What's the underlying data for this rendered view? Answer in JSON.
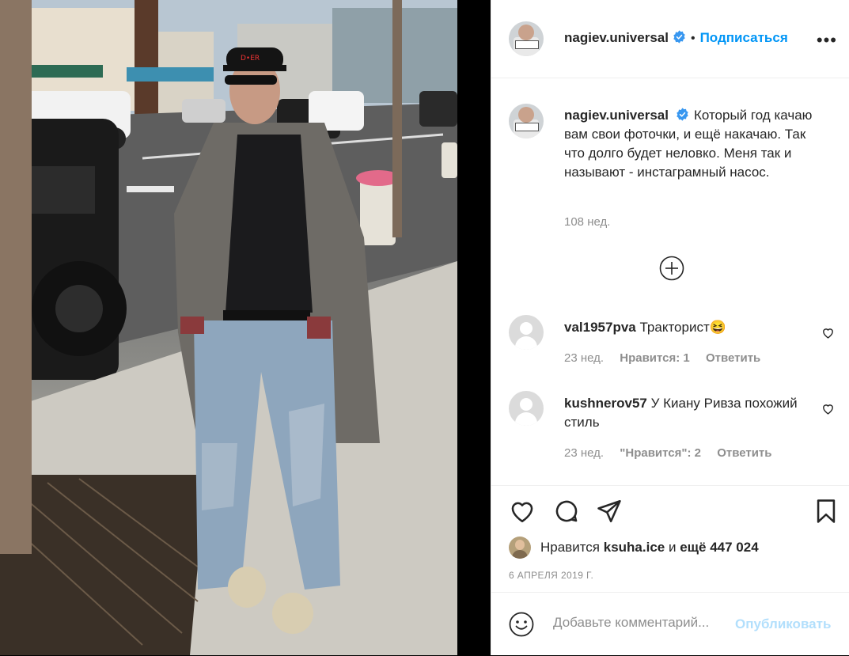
{
  "colors": {
    "accent": "#0095f6",
    "publish_disabled": "#b2dffc",
    "secondary_text": "#8e8e8e",
    "primary_text": "#262626"
  },
  "header": {
    "username": "nagiev.universal",
    "verified_icon": "verified-badge-icon",
    "separator": "•",
    "follow_label": "Подписаться",
    "more_label": "•••"
  },
  "caption": {
    "username": "nagiev.universal",
    "text": "Который год качаю вам свои фоточки, и ещё накачаю. Так что долго будет неловко. Меня так и называют - инстаграмный насос.",
    "age": "108 нед."
  },
  "load_more_icon": "circle-plus-icon",
  "comments": [
    {
      "username": "val1957pva",
      "text": "Тракторист😆",
      "age": "23 нед.",
      "likes": "Нравится: 1",
      "reply": "Ответить"
    },
    {
      "username": "kushnerov57",
      "text": "У Киану Ривза похожий стиль",
      "age": "23 нед.",
      "likes": "\"Нравится\": 2",
      "reply": "Ответить"
    }
  ],
  "likes": {
    "prefix": "Нравится",
    "user": "ksuha.ice",
    "conj": "и",
    "rest": "ещё 447 024"
  },
  "date": "6 АПРЕЛЯ 2019 Г.",
  "add_comment": {
    "placeholder": "Добавьте комментарий...",
    "publish_label": "Опубликовать"
  }
}
